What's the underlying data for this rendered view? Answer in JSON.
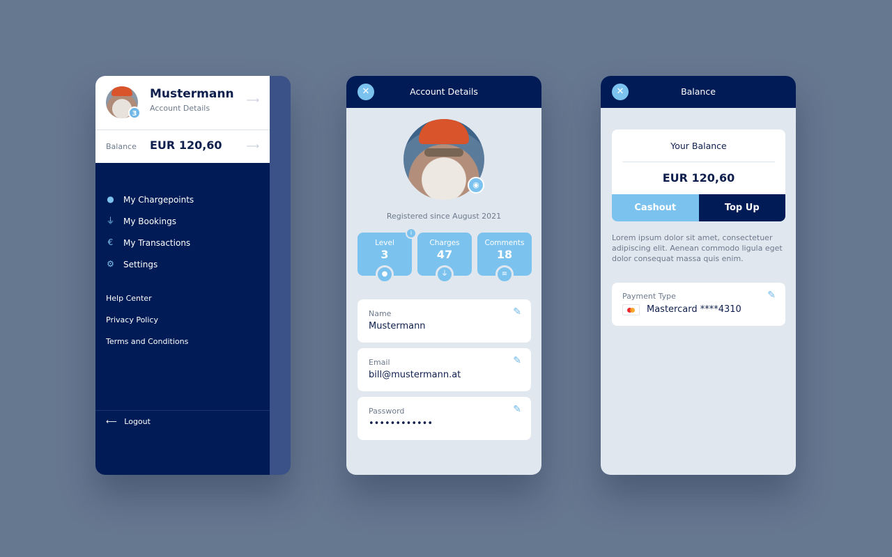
{
  "drawer": {
    "name": "Mustermann",
    "subtitle": "Account Details",
    "level_badge": "3",
    "balance_label": "Balance",
    "balance_value": "EUR 120,60",
    "menu": [
      {
        "label": "My Chargepoints",
        "icon": "map-pin-icon"
      },
      {
        "label": "My Bookings",
        "icon": "plug-icon"
      },
      {
        "label": "My Transactions",
        "icon": "euro-icon"
      },
      {
        "label": "Settings",
        "icon": "gear-icon"
      }
    ],
    "links": [
      "Help Center",
      "Privacy Policy",
      "Terms and Conditions"
    ],
    "logout": "Logout"
  },
  "account": {
    "title": "Account Details",
    "registered": "Registered since August 2021",
    "stats": [
      {
        "label": "Level",
        "value": "3"
      },
      {
        "label": "Charges",
        "value": "47"
      },
      {
        "label": "Comments",
        "value": "18"
      }
    ],
    "fields": [
      {
        "label": "Name",
        "value": "Mustermann"
      },
      {
        "label": "Email",
        "value": "bill@mustermann.at"
      },
      {
        "label": "Password",
        "value": "••••••••••••"
      }
    ]
  },
  "balance": {
    "title": "Balance",
    "card_title": "Your Balance",
    "amount": "EUR 120,60",
    "cashout": "Cashout",
    "topup": "Top Up",
    "description": "Lorem ipsum dolor sit amet, consectetuer adipiscing elit. Aenean commodo ligula eget dolor consequat massa quis enim.",
    "payment_label": "Payment Type",
    "payment_value": "Mastercard ****4310"
  },
  "colors": {
    "navy": "#001b55",
    "accent": "#7cc2ee",
    "background": "#667790"
  }
}
